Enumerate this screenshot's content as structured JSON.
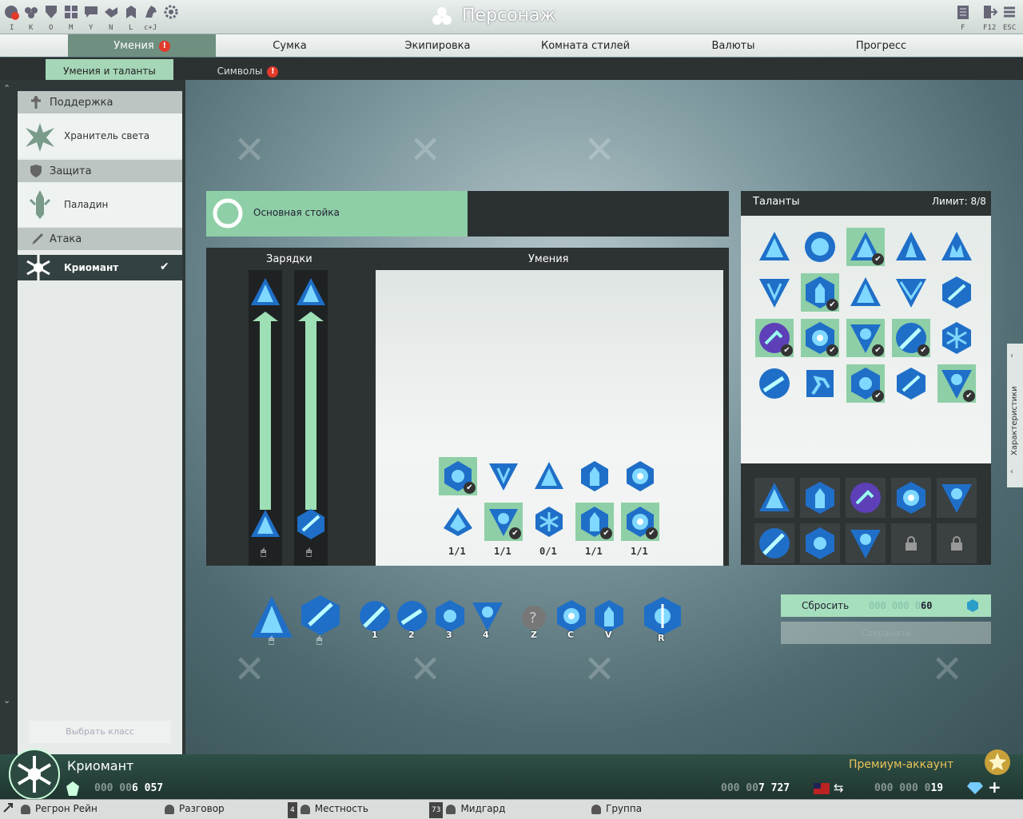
{
  "window": {
    "title": "Персонаж"
  },
  "toolbar": {
    "keys": [
      "I",
      "K",
      "O",
      "M",
      "Y",
      "N",
      "L",
      "c+J"
    ],
    "right_keys": [
      "F",
      "F12",
      "ESC"
    ]
  },
  "nav": {
    "tabs": [
      "Умения",
      "Сумка",
      "Экипировка",
      "Комната стилей",
      "Валюты",
      "Прогресс"
    ],
    "active": 0
  },
  "subnav": {
    "tabs": [
      "Умения и таланты",
      "Символы"
    ]
  },
  "classes": {
    "support": {
      "header": "Поддержка",
      "item": "Хранитель света"
    },
    "defense": {
      "header": "Защита",
      "item": "Паладин"
    },
    "attack": {
      "header": "Атака",
      "item": "Криомант"
    },
    "select_button": "Выбрать класс"
  },
  "stance": {
    "label": "Основная стойка"
  },
  "charges": {
    "header": "Зарядки"
  },
  "skills": {
    "header": "Умения",
    "counts": [
      "1/1",
      "1/1",
      "0/1",
      "1/1",
      "1/1"
    ]
  },
  "talents": {
    "header": "Таланты",
    "limit": "Лимит: 8/8"
  },
  "actionbar": {
    "keys": [
      "1",
      "2",
      "3",
      "4",
      "Z",
      "C",
      "V",
      "R"
    ]
  },
  "reset": {
    "label": "Сбросить",
    "cost_dim": "000 000 0",
    "cost": "60"
  },
  "save": {
    "label": "Сохранить"
  },
  "side": {
    "label": "Характеристики"
  },
  "bottom": {
    "class_name": "Криомант",
    "premium": "Премиум-аккаунт",
    "money1_dim": "000 00",
    "money1": "6 057",
    "money2_dim": "000 00",
    "money2": "7 727",
    "money3_dim": "000 000 0",
    "money3": "19"
  },
  "chat": {
    "tabs": [
      {
        "num": "",
        "label": "Регрон Рейн"
      },
      {
        "num": "",
        "label": "Разговор"
      },
      {
        "num": "4",
        "label": "Местность"
      },
      {
        "num": "73",
        "label": "Мидгард"
      },
      {
        "num": "",
        "label": "Группа"
      }
    ]
  },
  "colors": {
    "accent_green": "#8fcfa7",
    "badge": "#e23a2b",
    "icon_blue": "#2f8fe0"
  }
}
